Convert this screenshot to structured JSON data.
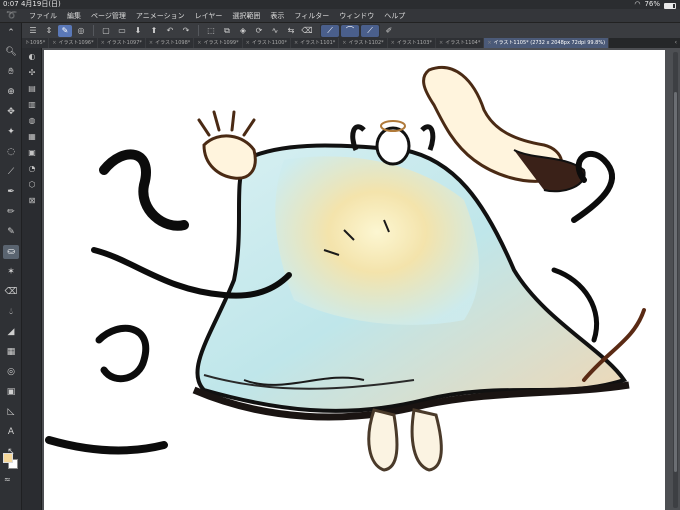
{
  "status": {
    "time": "0:07",
    "date": "4月19日(日)",
    "battery": "76%",
    "battery_level": 0.76
  },
  "menu": {
    "logo_icon": "clip-studio-logo-icon",
    "items": [
      "ファイル",
      "編集",
      "ページ管理",
      "アニメーション",
      "レイヤー",
      "選択範囲",
      "表示",
      "フィルター",
      "ウィンドウ",
      "ヘルプ"
    ]
  },
  "tabs": [
    {
      "label": "ト1095*"
    },
    {
      "label": "イラスト1096*"
    },
    {
      "label": "イラスト1097*"
    },
    {
      "label": "イラスト1098*"
    },
    {
      "label": "イラスト1099*"
    },
    {
      "label": "イラスト1100*"
    },
    {
      "label": "イラスト1101*"
    },
    {
      "label": "イラスト1102*"
    },
    {
      "label": "イラスト1103*"
    },
    {
      "label": "イラスト1104*"
    },
    {
      "label": "イラスト1105* (2732 x 2048px 72dpi 99.8%)",
      "current": true
    }
  ],
  "tab_more": "‹",
  "colors": {
    "foreground": "#f6d89a",
    "background": "#ffffff",
    "accent": "#5a78b8"
  }
}
